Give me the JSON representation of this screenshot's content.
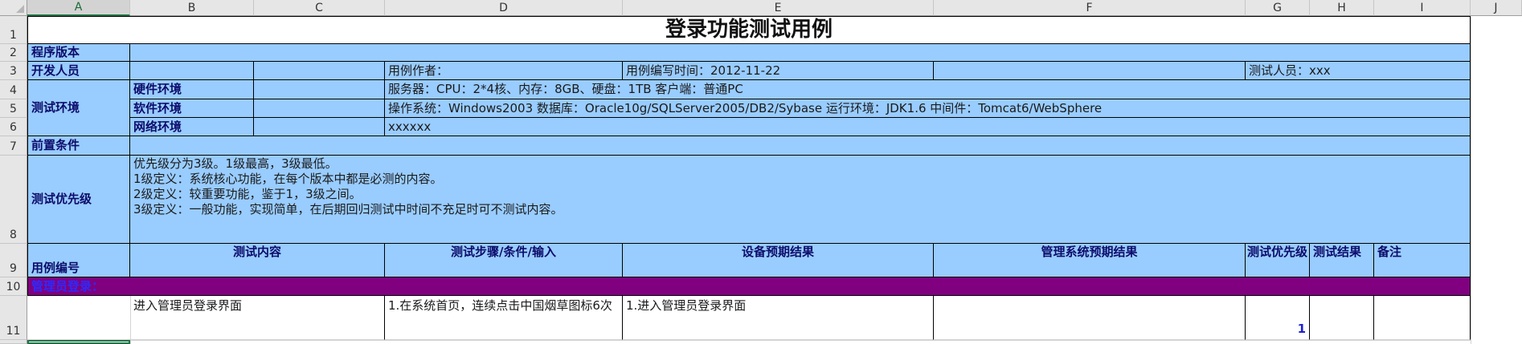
{
  "columns": [
    "A",
    "B",
    "C",
    "D",
    "E",
    "F",
    "G",
    "H",
    "I",
    "J"
  ],
  "rows": [
    "1",
    "2",
    "3",
    "4",
    "5",
    "6",
    "7",
    "8",
    "9",
    "10",
    "11"
  ],
  "title": "登录功能测试用例",
  "program_version_label": "程序版本",
  "developer_label": "开发人员",
  "case_author_label": "用例作者：",
  "case_time_label": "用例编写时间：2012-11-22",
  "tester_label": "测试人员：xxx",
  "test_env_label": "测试环境",
  "hardware_label": "硬件环境",
  "hardware_value": "服务器：CPU：2*4核、内存：8GB、硬盘：1TB 客户端：普通PC",
  "software_label": "软件环境",
  "software_value": "操作系统：Windows2003 数据库：Oracle10g/SQLServer2005/DB2/Sybase 运行环境：JDK1.6 中间件：Tomcat6/WebSphere",
  "network_label": "网络环境",
  "network_value": "xxxxxx",
  "precondition_label": "前置条件",
  "priority_label": "测试优先级",
  "priority_lines": [
    "优先级分为3级。1级最高，3级最低。",
    "1级定义：系统核心功能，在每个版本中都是必测的内容。",
    "2级定义：较重要功能，鉴于1，3级之间。",
    "3级定义：一般功能，实现简单，在后期回归测试中时间不充足时可不测试内容。"
  ],
  "headers": {
    "case_no": "用例编号",
    "content": "测试内容",
    "steps": "测试步骤/条件/输入",
    "device_expected": "设备预期结果",
    "admin_expected": "管理系统预期结果",
    "priority": "测试优先级",
    "result": "测试结果",
    "remark": "备注"
  },
  "section_label": "管理员登录：",
  "row11": {
    "content": "进入管理员登录界面",
    "steps": "1.在系统首页，连续点击中国烟草图标6次",
    "device_expected": "1.进入管理员登录界面",
    "priority": "1"
  }
}
